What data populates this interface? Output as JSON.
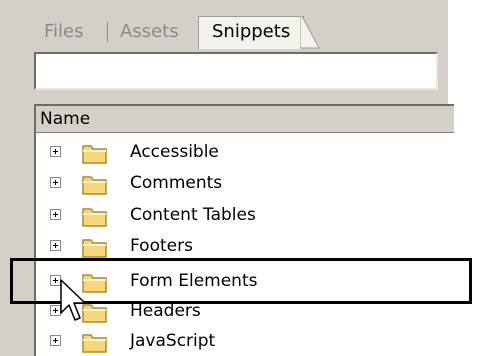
{
  "tabs": [
    {
      "label": "Files",
      "active": false
    },
    {
      "label": "Assets",
      "active": false
    },
    {
      "label": "Snippets",
      "active": true
    }
  ],
  "search": {
    "value": ""
  },
  "list": {
    "column_header": "Name",
    "items": [
      {
        "label": "Accessible",
        "icon": "folder-icon"
      },
      {
        "label": "Comments",
        "icon": "folder-icon"
      },
      {
        "label": "Content Tables",
        "icon": "folder-icon"
      },
      {
        "label": "Footers",
        "icon": "folder-icon"
      },
      {
        "label": "Form Elements",
        "icon": "folder-icon",
        "highlighted": true
      },
      {
        "label": "Headers",
        "icon": "folder-icon"
      },
      {
        "label": "JavaScript",
        "icon": "folder-icon"
      }
    ]
  },
  "colors": {
    "panel_bg": "#d4d0c8",
    "folder_fill": "#f6d77a",
    "folder_stroke": "#b08a2a",
    "highlight_border": "#000000"
  }
}
